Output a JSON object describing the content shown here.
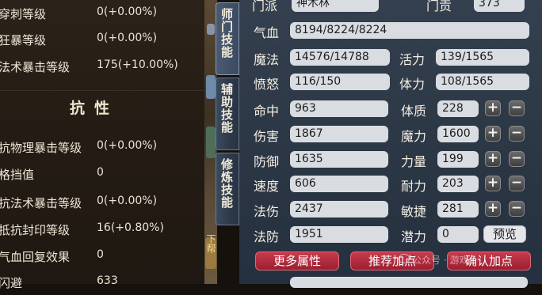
{
  "left": {
    "rows_top": [
      {
        "label": "穿刺等级",
        "value": "0(+0.00%)"
      },
      {
        "label": "狂暴等级",
        "value": "0(+0.00%)"
      },
      {
        "label": "法术暴击等级",
        "value": "175(+10.00%)"
      }
    ],
    "section_title": "抗性",
    "rows_bottom": [
      {
        "label": "抗物理暴击等级",
        "value": "0(+0.00%)"
      },
      {
        "label": "格挡值",
        "value": "0"
      },
      {
        "label": "抗法术暴击等级",
        "value": "0(+0.00%)"
      },
      {
        "label": "抵抗封印等级",
        "value": "16(+0.80%)"
      },
      {
        "label": "气血回复效果",
        "value": "0"
      },
      {
        "label": "闪避",
        "value": "633"
      }
    ]
  },
  "tabs": [
    {
      "label": "师门技能"
    },
    {
      "label": "辅助技能"
    },
    {
      "label": "修炼技能"
    }
  ],
  "strip_text": "下帮",
  "right": {
    "school": {
      "label": "门派",
      "value": "神木林"
    },
    "contribution": {
      "label": "门贡",
      "value": "373"
    },
    "hp": {
      "label": "气血",
      "value": "8194/8224/8224"
    },
    "mp": {
      "label": "魔法",
      "value": "14576/14788"
    },
    "vitality": {
      "label": "活力",
      "value": "139/1565"
    },
    "anger": {
      "label": "愤怒",
      "value": "116/150"
    },
    "stamina": {
      "label": "体力",
      "value": "108/1565"
    },
    "combat": [
      {
        "label": "命中",
        "value": "963"
      },
      {
        "label": "伤害",
        "value": "1867"
      },
      {
        "label": "防御",
        "value": "1635"
      },
      {
        "label": "速度",
        "value": "606"
      },
      {
        "label": "法伤",
        "value": "2437"
      },
      {
        "label": "法防",
        "value": "1951"
      }
    ],
    "attributes": [
      {
        "label": "体质",
        "value": "228"
      },
      {
        "label": "魔力",
        "value": "1600"
      },
      {
        "label": "力量",
        "value": "199"
      },
      {
        "label": "耐力",
        "value": "203"
      },
      {
        "label": "敏捷",
        "value": "281"
      }
    ],
    "potential": {
      "label": "潜力",
      "value": "0"
    },
    "plus": "+",
    "minus": "−",
    "preview_label": "预览",
    "more_attributes_label": "更多属性",
    "recommend_label": "推荐加点",
    "confirm_label": "确认加点"
  },
  "watermark": "公众号 · 游戏",
  "colors": {
    "field_bg": "#d9dde2",
    "button_red": "#b02a3c",
    "panel_blue": "#2f3a48"
  }
}
